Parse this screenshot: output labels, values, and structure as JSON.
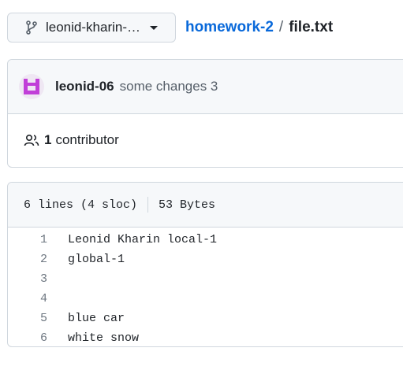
{
  "header": {
    "branch_label": "leonid-kharin-…",
    "repo_link": "homework-2",
    "separator": "/",
    "file_name": "file.txt"
  },
  "commit": {
    "author": "leonid-06",
    "message": "some changes 3"
  },
  "contributors": {
    "count": "1",
    "label": "contributor"
  },
  "file_info": {
    "lines": "6 lines (4 sloc)",
    "size": "53 Bytes"
  },
  "code_lines": [
    {
      "num": "1",
      "text": "Leonid Kharin local-1"
    },
    {
      "num": "2",
      "text": "global-1"
    },
    {
      "num": "3",
      "text": ""
    },
    {
      "num": "4",
      "text": ""
    },
    {
      "num": "5",
      "text": "blue car"
    },
    {
      "num": "6",
      "text": "white snow"
    }
  ],
  "colors": {
    "link": "#0969da",
    "avatar_fg": "#c13fd8",
    "border": "#d0d7de",
    "header_bg": "#f6f8fa"
  }
}
